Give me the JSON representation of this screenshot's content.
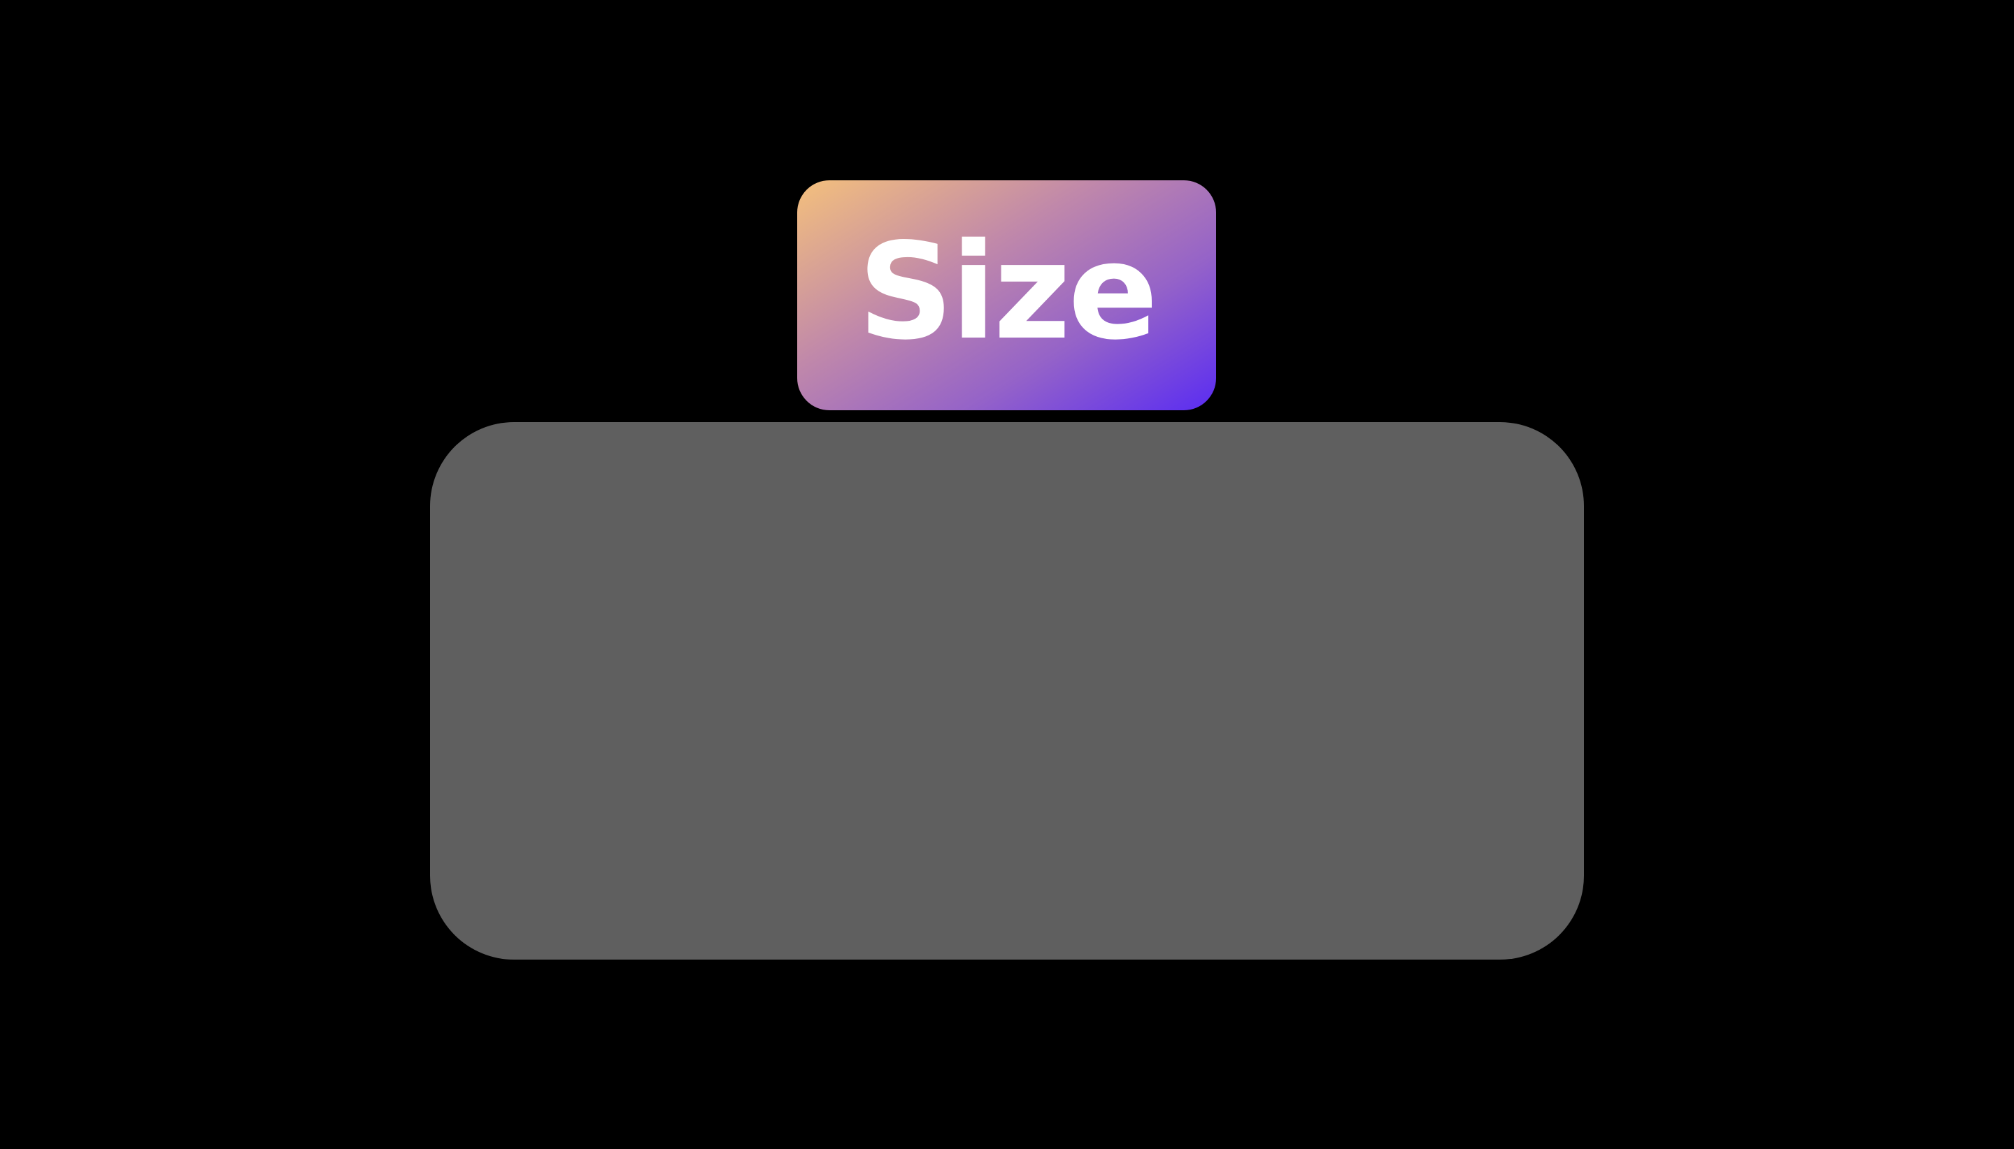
{
  "badge": {
    "label": "Size",
    "gradient_colors": [
      "#f4c07c",
      "#c088aa",
      "#9563c8",
      "#5a2cf2"
    ]
  },
  "content_box": {
    "color": "#5f5f5f"
  },
  "background_color": "#000000"
}
